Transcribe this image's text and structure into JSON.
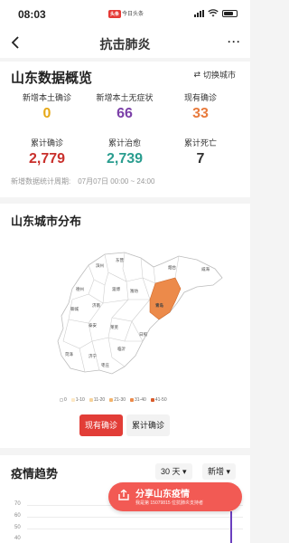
{
  "status_bar": {
    "time": "08:03",
    "badge": "头条",
    "app_label": "今日头条"
  },
  "nav": {
    "title": "抗击肺炎",
    "more": "···"
  },
  "overview": {
    "title": "山东数据概览",
    "switch_label": "切换城市",
    "stats": [
      {
        "label": "新增本土确诊",
        "value": "0",
        "color": "#e6a817"
      },
      {
        "label": "新增本土无症状",
        "value": "66",
        "color": "#7b3fa8"
      },
      {
        "label": "现有确诊",
        "value": "33",
        "color": "#e87a3c"
      },
      {
        "label": "累计确诊",
        "value": "2,779",
        "color": "#c9302c"
      },
      {
        "label": "累计治愈",
        "value": "2,739",
        "color": "#2a9d8f"
      },
      {
        "label": "累计死亡",
        "value": "7",
        "color": "#333333"
      }
    ],
    "period_label": "新增数据统计周期:",
    "period_value": "07月07日 00:00 ~ 24:00"
  },
  "distribution": {
    "title": "山东城市分布",
    "cities": [
      {
        "name": "滨州"
      },
      {
        "name": "东营"
      },
      {
        "name": "烟台"
      },
      {
        "name": "威海"
      },
      {
        "name": "德州"
      },
      {
        "name": "淄博"
      },
      {
        "name": "潍坊"
      },
      {
        "name": "聊城"
      },
      {
        "name": "济南"
      },
      {
        "name": "青岛",
        "highlight": true
      },
      {
        "name": "泰安"
      },
      {
        "name": "莱芜"
      },
      {
        "name": "日照"
      },
      {
        "name": "菏泽"
      },
      {
        "name": "济宁"
      },
      {
        "name": "临沂"
      },
      {
        "name": "枣庄"
      }
    ],
    "legend": [
      {
        "label": "0",
        "color": "#ffffff"
      },
      {
        "label": "1-10",
        "color": "#fde8c4"
      },
      {
        "label": "11-20",
        "color": "#f7d39a"
      },
      {
        "label": "21-30",
        "color": "#f3b36a"
      },
      {
        "label": "31-40",
        "color": "#ec8a4a"
      },
      {
        "label": "41-50",
        "color": "#d95b2a"
      }
    ],
    "highlight_color": "#ec8a4a",
    "tab_current": "现有确诊",
    "tab_cumulative": "累计确诊"
  },
  "trend": {
    "title": "疫情趋势",
    "range": "30 天",
    "metric": "新增",
    "y_ticks": [
      "70",
      "60",
      "50",
      "40"
    ]
  },
  "share": {
    "title": "分享山东疫情",
    "subtitle": "我是第 15079815 位抗肺炎支持者"
  }
}
